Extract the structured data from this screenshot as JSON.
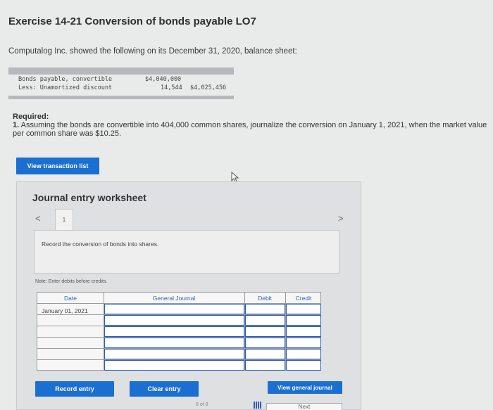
{
  "title": "Exercise 14-21 Conversion of bonds payable LO7",
  "intro": "Computalog Inc. showed the following on its December 31, 2020, balance sheet:",
  "balance_sheet": {
    "row1": {
      "label": "Bonds payable, convertible",
      "amount": "$4,040,000",
      "total": ""
    },
    "row2": {
      "label": "Less: Unamortized discount",
      "amount": "14,544",
      "total": "$4,025,456"
    }
  },
  "required": {
    "heading": "Required:",
    "number": "1.",
    "text": "Assuming the bonds are convertible into 404,000 common shares, journalize the conversion on January 1, 2021, when the market value per common share was $10.25."
  },
  "buttons": {
    "view_transaction_list": "View transaction list",
    "record_entry": "Record entry",
    "clear_entry": "Clear entry",
    "view_general_journal": "View general journal",
    "next": "Next"
  },
  "worksheet": {
    "title": "Journal entry worksheet",
    "prev": "<",
    "next": ">",
    "tab": "1",
    "instruction": "Record the conversion of bonds into shares.",
    "note": "Note: Enter debits before credits.",
    "columns": {
      "date": "Date",
      "general_journal": "General Journal",
      "debit": "Debit",
      "credit": "Credit"
    },
    "date_value": "January 01, 2021"
  },
  "pager": "8 of 8",
  "colors": {
    "accent": "#1a6fd1",
    "background": "#e9eaea"
  }
}
